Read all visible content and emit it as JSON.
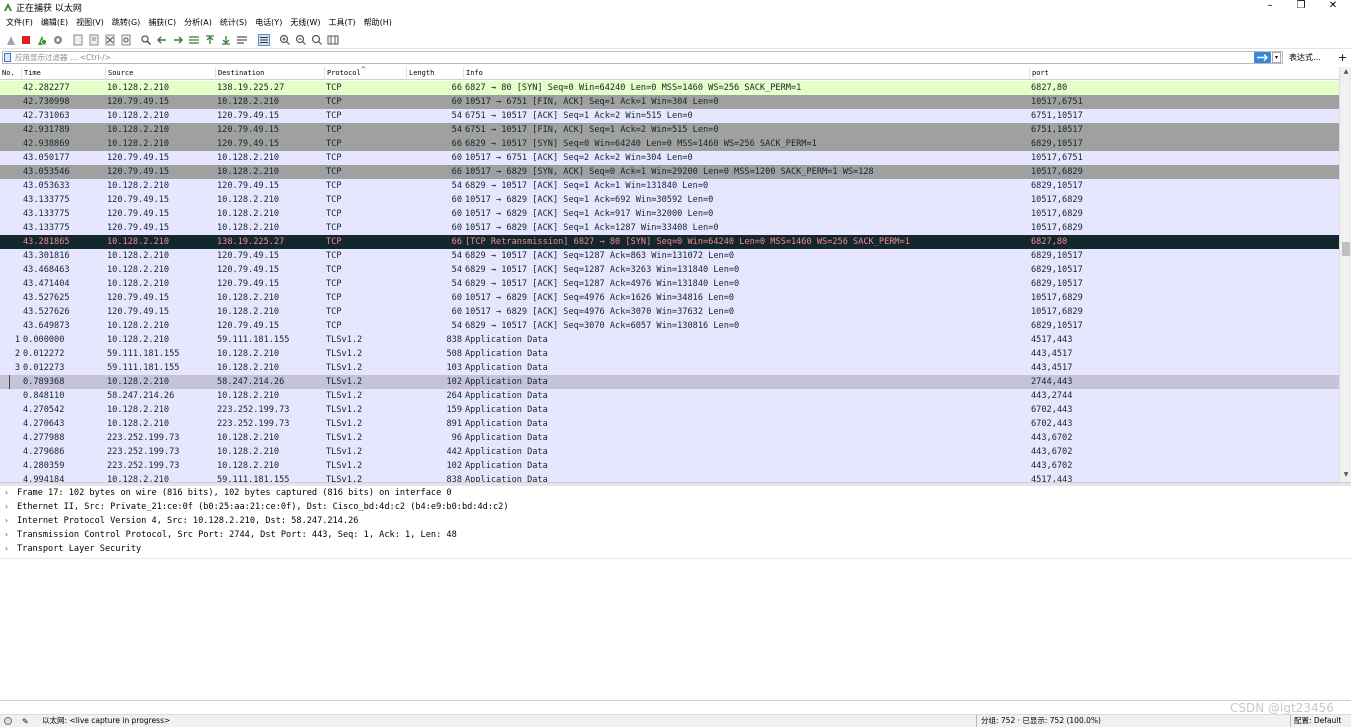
{
  "window": {
    "title": "正在捕获 以太网",
    "controls": {
      "minimize": "–",
      "maximize": "❐",
      "close": "✕"
    }
  },
  "menu": [
    "文件(F)",
    "编辑(E)",
    "视图(V)",
    "跳转(G)",
    "捕获(C)",
    "分析(A)",
    "统计(S)",
    "电话(Y)",
    "无线(W)",
    "工具(T)",
    "帮助(H)"
  ],
  "filter": {
    "placeholder": "应用显示过滤器 … <Ctrl-/>",
    "expression_label": "表达式…",
    "plus_label": "+"
  },
  "columns": [
    "No.",
    "Time",
    "Source",
    "Destination",
    "Protocol",
    "Length",
    "Info",
    "port"
  ],
  "packets": [
    {
      "no": "",
      "time": "42.282277",
      "src": "10.128.2.210",
      "dst": "138.19.225.27",
      "proto": "TCP",
      "len": "66",
      "info": "6827 → 80 [SYN] Seq=0 Win=64240 Len=0 MSS=1460 WS=256 SACK_PERM=1",
      "port": "6827,80",
      "style": "synack"
    },
    {
      "no": "",
      "time": "42.730998",
      "src": "120.79.49.15",
      "dst": "10.128.2.210",
      "proto": "TCP",
      "len": "60",
      "info": "10517 → 6751 [FIN, ACK] Seq=1 Ack=1 Win=304 Len=0",
      "port": "10517,6751",
      "style": "fin"
    },
    {
      "no": "",
      "time": "42.731063",
      "src": "10.128.2.210",
      "dst": "120.79.49.15",
      "proto": "TCP",
      "len": "54",
      "info": "6751 → 10517 [ACK] Seq=1 Ack=2 Win=515 Len=0",
      "port": "6751,10517",
      "style": "tcp"
    },
    {
      "no": "",
      "time": "42.931789",
      "src": "10.128.2.210",
      "dst": "120.79.49.15",
      "proto": "TCP",
      "len": "54",
      "info": "6751 → 10517 [FIN, ACK] Seq=1 Ack=2 Win=515 Len=0",
      "port": "6751,10517",
      "style": "fin"
    },
    {
      "no": "",
      "time": "42.938869",
      "src": "10.128.2.210",
      "dst": "120.79.49.15",
      "proto": "TCP",
      "len": "66",
      "info": "6829 → 10517 [SYN] Seq=0 Win=64240 Len=0 MSS=1460 WS=256 SACK_PERM=1",
      "port": "6829,10517",
      "style": "fin"
    },
    {
      "no": "",
      "time": "43.050177",
      "src": "120.79.49.15",
      "dst": "10.128.2.210",
      "proto": "TCP",
      "len": "60",
      "info": "10517 → 6751 [ACK] Seq=2 Ack=2 Win=304 Len=0",
      "port": "10517,6751",
      "style": "tcp"
    },
    {
      "no": "",
      "time": "43.053546",
      "src": "120.79.49.15",
      "dst": "10.128.2.210",
      "proto": "TCP",
      "len": "66",
      "info": "10517 → 6829 [SYN, ACK] Seq=0 Ack=1 Win=29200 Len=0 MSS=1200 SACK_PERM=1 WS=128",
      "port": "10517,6829",
      "style": "fin"
    },
    {
      "no": "",
      "time": "43.053633",
      "src": "10.128.2.210",
      "dst": "120.79.49.15",
      "proto": "TCP",
      "len": "54",
      "info": "6829 → 10517 [ACK] Seq=1 Ack=1 Win=131840 Len=0",
      "port": "6829,10517",
      "style": "tcp"
    },
    {
      "no": "",
      "time": "43.133775",
      "src": "120.79.49.15",
      "dst": "10.128.2.210",
      "proto": "TCP",
      "len": "60",
      "info": "10517 → 6829 [ACK] Seq=1 Ack=692 Win=30592 Len=0",
      "port": "10517,6829",
      "style": "tcp"
    },
    {
      "no": "",
      "time": "43.133775",
      "src": "120.79.49.15",
      "dst": "10.128.2.210",
      "proto": "TCP",
      "len": "60",
      "info": "10517 → 6829 [ACK] Seq=1 Ack=917 Win=32000 Len=0",
      "port": "10517,6829",
      "style": "tcp"
    },
    {
      "no": "",
      "time": "43.133775",
      "src": "120.79.49.15",
      "dst": "10.128.2.210",
      "proto": "TCP",
      "len": "60",
      "info": "10517 → 6829 [ACK] Seq=1 Ack=1287 Win=33408 Len=0",
      "port": "10517,6829",
      "style": "tcp"
    },
    {
      "no": "",
      "time": "43.281865",
      "src": "10.128.2.210",
      "dst": "138.19.225.27",
      "proto": "TCP",
      "len": "66",
      "info": "[TCP Retransmission] 6827 → 80 [SYN] Seq=0 Win=64240 Len=0 MSS=1460 WS=256 SACK_PERM=1",
      "port": "6827,80",
      "style": "retrans"
    },
    {
      "no": "",
      "time": "43.301816",
      "src": "10.128.2.210",
      "dst": "120.79.49.15",
      "proto": "TCP",
      "len": "54",
      "info": "6829 → 10517 [ACK] Seq=1287 Ack=863 Win=131072 Len=0",
      "port": "6829,10517",
      "style": "tcp"
    },
    {
      "no": "",
      "time": "43.468463",
      "src": "10.128.2.210",
      "dst": "120.79.49.15",
      "proto": "TCP",
      "len": "54",
      "info": "6829 → 10517 [ACK] Seq=1287 Ack=3263 Win=131840 Len=0",
      "port": "6829,10517",
      "style": "tcp"
    },
    {
      "no": "",
      "time": "43.471404",
      "src": "10.128.2.210",
      "dst": "120.79.49.15",
      "proto": "TCP",
      "len": "54",
      "info": "6829 → 10517 [ACK] Seq=1287 Ack=4976 Win=131840 Len=0",
      "port": "6829,10517",
      "style": "tcp"
    },
    {
      "no": "",
      "time": "43.527625",
      "src": "120.79.49.15",
      "dst": "10.128.2.210",
      "proto": "TCP",
      "len": "60",
      "info": "10517 → 6829 [ACK] Seq=4976 Ack=1626 Win=34816 Len=0",
      "port": "10517,6829",
      "style": "tcp"
    },
    {
      "no": "",
      "time": "43.527626",
      "src": "120.79.49.15",
      "dst": "10.128.2.210",
      "proto": "TCP",
      "len": "60",
      "info": "10517 → 6829 [ACK] Seq=4976 Ack=3070 Win=37632 Len=0",
      "port": "10517,6829",
      "style": "tcp"
    },
    {
      "no": "",
      "time": "43.649873",
      "src": "10.128.2.210",
      "dst": "120.79.49.15",
      "proto": "TCP",
      "len": "54",
      "info": "6829 → 10517 [ACK] Seq=3070 Ack=6057 Win=130816 Len=0",
      "port": "6829,10517",
      "style": "tcp"
    },
    {
      "no": "1",
      "time": "0.000000",
      "src": "10.128.2.210",
      "dst": "59.111.181.155",
      "proto": "TLSv1.2",
      "len": "838",
      "info": "Application Data",
      "port": "4517,443",
      "style": "tcp"
    },
    {
      "no": "2",
      "time": "0.012272",
      "src": "59.111.181.155",
      "dst": "10.128.2.210",
      "proto": "TLSv1.2",
      "len": "508",
      "info": "Application Data",
      "port": "443,4517",
      "style": "tcp"
    },
    {
      "no": "3",
      "time": "0.012273",
      "src": "59.111.181.155",
      "dst": "10.128.2.210",
      "proto": "TLSv1.2",
      "len": "103",
      "info": "Application Data",
      "port": "443,4517",
      "style": "tcp"
    },
    {
      "no": "",
      "time": "0.789368",
      "src": "10.128.2.210",
      "dst": "58.247.214.26",
      "proto": "TLSv1.2",
      "len": "102",
      "info": "Application Data",
      "port": "2744,443",
      "style": "sel"
    },
    {
      "no": "",
      "time": "0.848110",
      "src": "58.247.214.26",
      "dst": "10.128.2.210",
      "proto": "TLSv1.2",
      "len": "264",
      "info": "Application Data",
      "port": "443,2744",
      "style": "tcp"
    },
    {
      "no": "",
      "time": "4.270542",
      "src": "10.128.2.210",
      "dst": "223.252.199.73",
      "proto": "TLSv1.2",
      "len": "159",
      "info": "Application Data",
      "port": "6702,443",
      "style": "tcp"
    },
    {
      "no": "",
      "time": "4.270643",
      "src": "10.128.2.210",
      "dst": "223.252.199.73",
      "proto": "TLSv1.2",
      "len": "891",
      "info": "Application Data",
      "port": "6702,443",
      "style": "tcp"
    },
    {
      "no": "",
      "time": "4.277988",
      "src": "223.252.199.73",
      "dst": "10.128.2.210",
      "proto": "TLSv1.2",
      "len": "96",
      "info": "Application Data",
      "port": "443,6702",
      "style": "tcp"
    },
    {
      "no": "",
      "time": "4.279686",
      "src": "223.252.199.73",
      "dst": "10.128.2.210",
      "proto": "TLSv1.2",
      "len": "442",
      "info": "Application Data",
      "port": "443,6702",
      "style": "tcp"
    },
    {
      "no": "",
      "time": "4.280359",
      "src": "223.252.199.73",
      "dst": "10.128.2.210",
      "proto": "TLSv1.2",
      "len": "102",
      "info": "Application Data",
      "port": "443,6702",
      "style": "tcp"
    },
    {
      "no": "",
      "time": "4.994184",
      "src": "10.128.2.210",
      "dst": "59.111.181.155",
      "proto": "TLSv1.2",
      "len": "838",
      "info": "Application Data",
      "port": "4517,443",
      "style": "tcp"
    }
  ],
  "details": [
    "Frame 17: 102 bytes on wire (816 bits), 102 bytes captured (816 bits) on interface 0",
    "Ethernet II, Src: Private_21:ce:0f (b0:25:aa:21:ce:0f), Dst: Cisco_bd:4d:c2 (b4:e9:b0:bd:4d:c2)",
    "Internet Protocol Version 4, Src: 10.128.2.210, Dst: 58.247.214.26",
    "Transmission Control Protocol, Src Port: 2744, Dst Port: 443, Seq: 1, Ack: 1, Len: 48",
    "Transport Layer Security"
  ],
  "status": {
    "interface_text": "以太网: <live capture in progress>",
    "counts_text": "分组: 752 · 已显示: 752 (100.0%)",
    "profile_text": "配置: Default",
    "watermark": "CSDN @lgt23456"
  },
  "colors": {
    "synack": "#e4ffc7",
    "fin": "#a0a0a0",
    "tcp": "#e7e6ff",
    "retrans_bg": "#12272e",
    "retrans_fg": "#f78787",
    "selected": "#c6c3d6"
  }
}
